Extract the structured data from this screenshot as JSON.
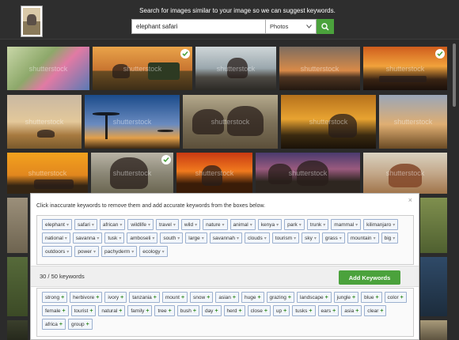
{
  "header": {
    "prompt": "Search for images similar to your image so we can suggest keywords.",
    "search_value": "elephant safari",
    "media_type": "Photos"
  },
  "watermark": "shutterstock",
  "panel": {
    "instruction": "Click inaccurate keywords to remove them and add accurate keywords from the boxes below.",
    "close": "×",
    "selected_keywords": [
      "elephant",
      "safari",
      "african",
      "wildlife",
      "travel",
      "wild",
      "nature",
      "animal",
      "kenya",
      "park",
      "trunk",
      "mammal",
      "kilimanjaro",
      "national",
      "savanna",
      "tusk",
      "amboseli",
      "south",
      "large",
      "savannah",
      "clouds",
      "tourism",
      "sky",
      "grass",
      "mountain",
      "big",
      "outdoors",
      "power",
      "pachyderm",
      "ecology"
    ],
    "count": "30 / 50 keywords",
    "add_button": "Add Keywords",
    "suggested_keywords": [
      "strong",
      "herbivore",
      "ivory",
      "tanzania",
      "mount",
      "snow",
      "asian",
      "huge",
      "grazing",
      "landscape",
      "jungle",
      "blue",
      "color",
      "female",
      "tourist",
      "natural",
      "family",
      "tree",
      "bush",
      "day",
      "herd",
      "close",
      "up",
      "tusks",
      "ears",
      "asia",
      "clear",
      "africa",
      "group"
    ]
  }
}
